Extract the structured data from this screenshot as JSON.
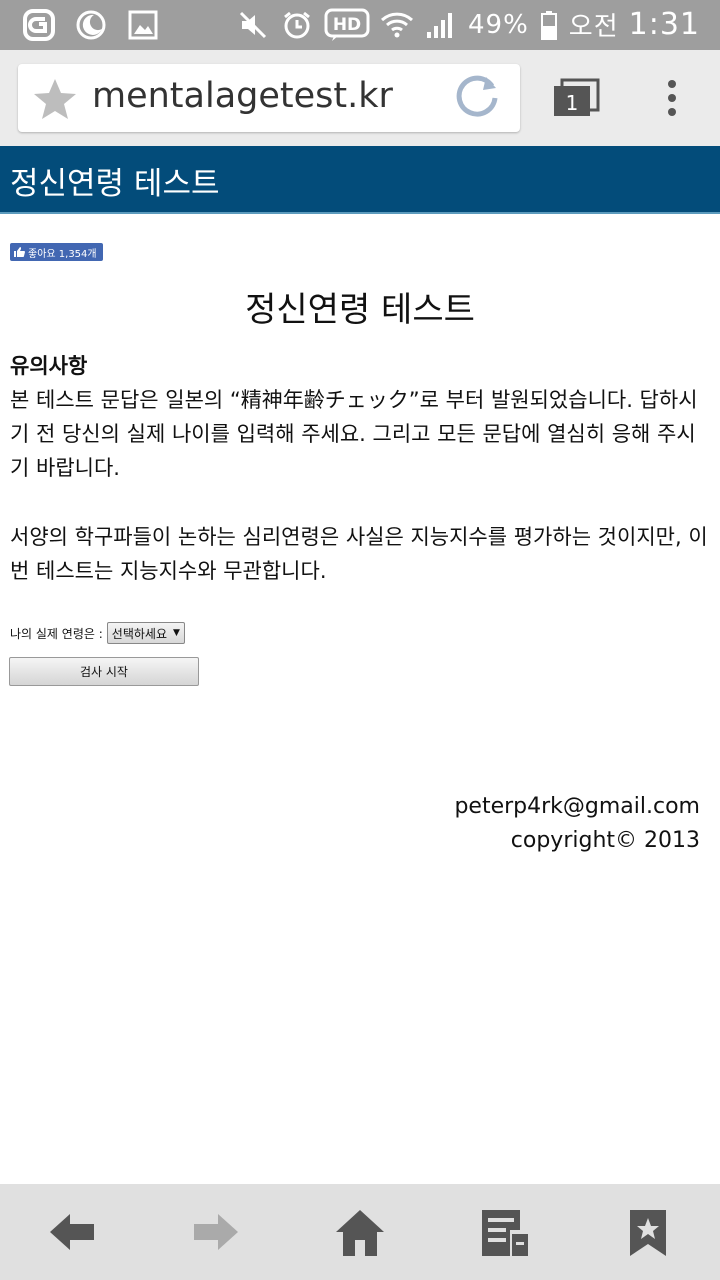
{
  "status_bar": {
    "battery": "49%",
    "ampm": "오전",
    "time": "1:31",
    "icons": [
      "g-icon",
      "moon-icon",
      "image-icon",
      "mute-icon",
      "alarm-icon",
      "hd-icon",
      "wifi-icon",
      "signal-icon",
      "battery-icon"
    ]
  },
  "browser": {
    "url": "mentalagetest.kr",
    "tab_count": "1"
  },
  "header": {
    "title": "정신연령 테스트"
  },
  "like": {
    "label": "좋아요 1,354개"
  },
  "page": {
    "title": "정신연령 테스트",
    "notice_heading": "유의사항",
    "notice_text": "본 테스트 문답은 일본의 “精神年齢チェック”로 부터 발원되었습니다. 답하시기 전 당신의 실제 나이를 입력해 주세요. 그리고 모든 문답에 열심히 응해 주시기 바랍니다.",
    "notice_text2": "서양의 학구파들이 논하는 심리연령은 사실은 지능지수를 평가하는 것이지만, 이번 테스트는 지능지수와 무관합니다.",
    "age_label": "나의 실제 연령은 :",
    "age_select_value": "선택하세요",
    "start_button": "검사 시작"
  },
  "footer": {
    "email": "peterp4rk@gmail.com",
    "copyright": "copyright© 2013"
  },
  "bottom_nav": [
    "back-icon",
    "forward-icon",
    "home-icon",
    "reader-icon",
    "bookmark-icon"
  ]
}
